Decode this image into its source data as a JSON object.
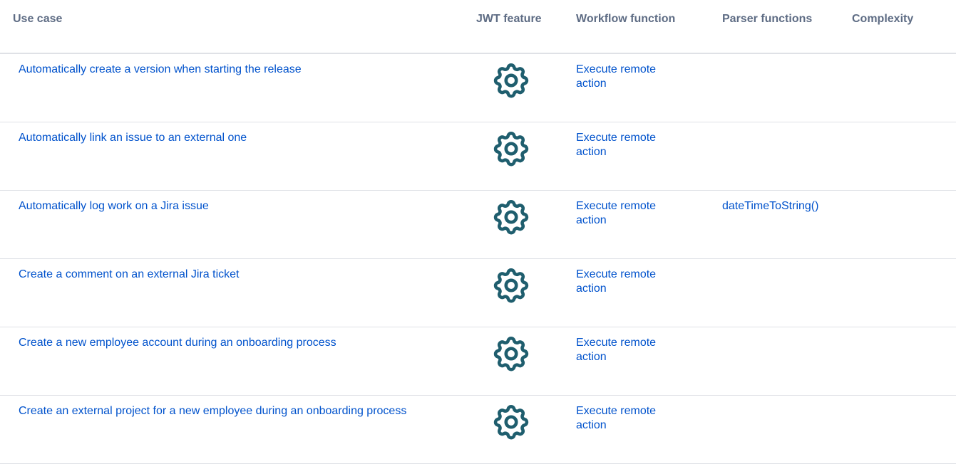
{
  "header": {
    "use_case": "Use case",
    "jwt_feature": "JWT feature",
    "workflow_function": "Workflow function",
    "parser_functions": "Parser functions",
    "complexity": "Complexity"
  },
  "rows": [
    {
      "use_case": "Automatically create a version when starting the release",
      "jwt_icon": "gear-icon",
      "workflow_function": "Execute remote action",
      "parser_functions": "",
      "complexity": ""
    },
    {
      "use_case": "Automatically link an issue to an external one",
      "jwt_icon": "gear-icon",
      "workflow_function": "Execute remote action",
      "parser_functions": "",
      "complexity": ""
    },
    {
      "use_case": "Automatically log work on a Jira issue",
      "jwt_icon": "gear-icon",
      "workflow_function": "Execute remote action",
      "parser_functions": "dateTimeToString()",
      "complexity": ""
    },
    {
      "use_case": "Create a comment on an external Jira ticket",
      "jwt_icon": "gear-icon",
      "workflow_function": "Execute remote action",
      "parser_functions": "",
      "complexity": ""
    },
    {
      "use_case": "Create a new employee account during an onboarding process",
      "jwt_icon": "gear-icon",
      "workflow_function": "Execute remote action",
      "parser_functions": "",
      "complexity": ""
    },
    {
      "use_case": "Create an external project for a new employee during an onboarding process",
      "jwt_icon": "gear-icon",
      "workflow_function": "Execute remote action",
      "parser_functions": "",
      "complexity": ""
    }
  ],
  "colors": {
    "header_text": "#5e6c84",
    "link": "#0052cc",
    "icon": "#1f5e6e",
    "border": "#dfe1e6"
  }
}
